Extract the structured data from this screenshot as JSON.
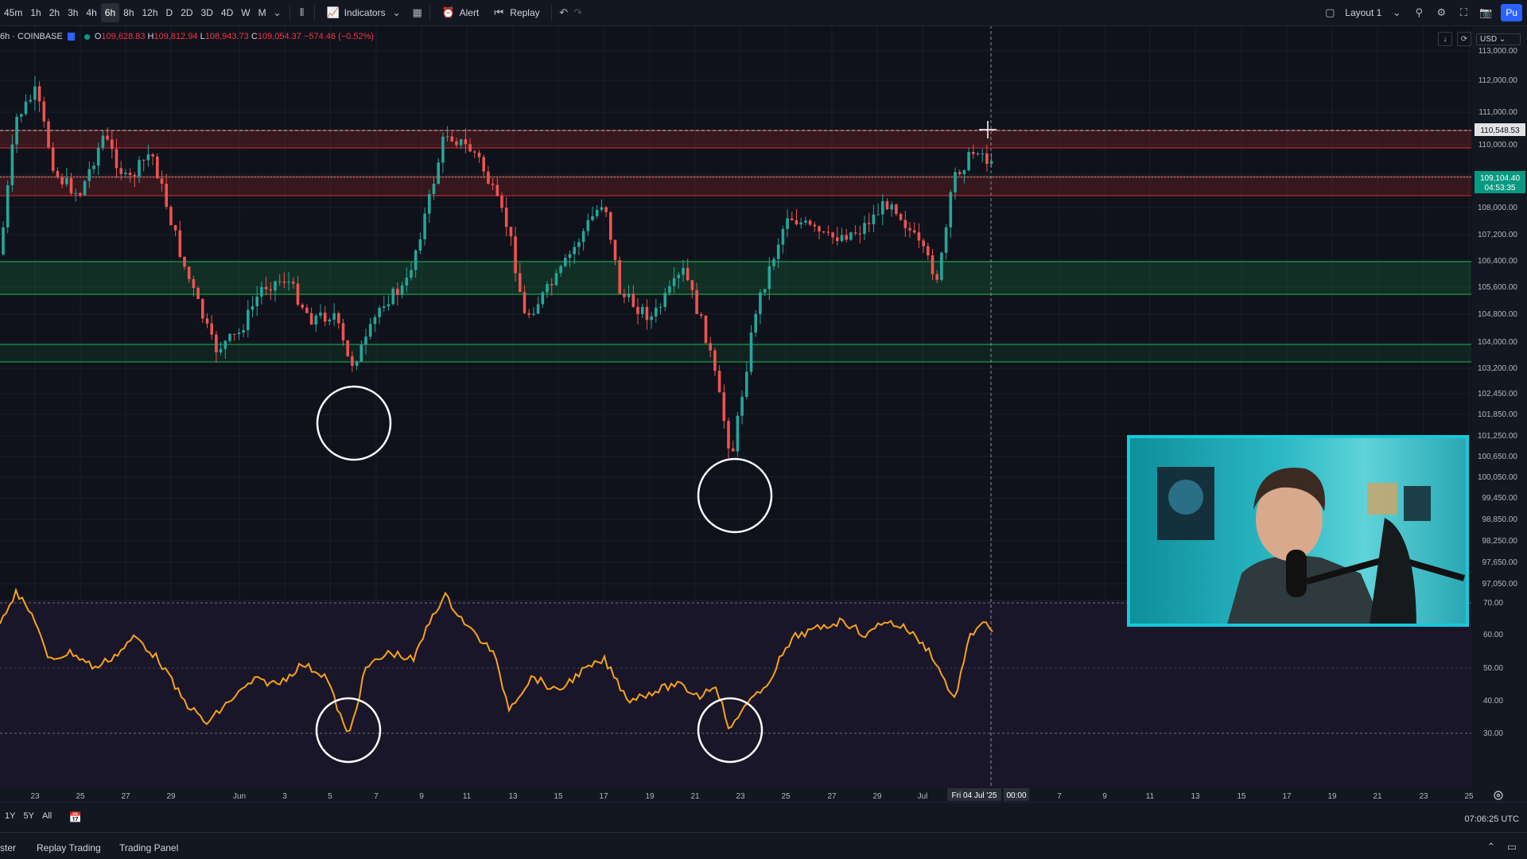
{
  "toolbar": {
    "timeframes": [
      "45m",
      "1h",
      "2h",
      "3h",
      "4h",
      "6h",
      "8h",
      "12h",
      "D",
      "2D",
      "3D",
      "4D",
      "W",
      "M"
    ],
    "active_timeframe": "6h",
    "indicators_label": "Indicators",
    "alert_label": "Alert",
    "replay_label": "Replay",
    "layout_label": "Layout 1",
    "publish_label": "Pu"
  },
  "legend": {
    "symbol": "6h · COINBASE",
    "open_label": "O",
    "open": "109,628.83",
    "high_label": "H",
    "high": "109,812.94",
    "low_label": "L",
    "low": "108,943.73",
    "close_label": "C",
    "close": "109,054.37",
    "change": "−574.46 (−0.52%)"
  },
  "price_scale": {
    "currency": "USD",
    "labels": [
      "113,000.00",
      "112,000.00",
      "111,000.00",
      "110,000.00",
      "108,800.00",
      "108,000.00",
      "107,200.00",
      "106,400.00",
      "105,600.00",
      "104,800.00",
      "104,000.00",
      "103,200.00",
      "102,450.00",
      "101,850.00",
      "101,250.00",
      "100,650.00",
      "100,050.00",
      "99,450.00",
      "98,850.00",
      "98,250.00",
      "97,650.00",
      "97,050.00"
    ],
    "crosshair_price": "110,548.53",
    "last_price": "109,104.40",
    "countdown": "04:53:35"
  },
  "rsi_scale": {
    "labels": [
      "70.00",
      "60.00",
      "50.00",
      "40.00",
      "30.00"
    ]
  },
  "time_axis": {
    "labels": [
      "23",
      "25",
      "27",
      "29",
      "Jun",
      "3",
      "5",
      "7",
      "9",
      "11",
      "13",
      "15",
      "17",
      "19",
      "21",
      "23",
      "25",
      "27",
      "29",
      "Jul",
      "7",
      "9",
      "11",
      "13",
      "15",
      "17",
      "19",
      "21",
      "23",
      "25"
    ],
    "crosshair_date": "Fri 04 Jul '25",
    "crosshair_time": "00:00"
  },
  "bottom": {
    "ranges": [
      "1Y",
      "5Y",
      "All"
    ],
    "clock": "07:06:25 UTC"
  },
  "tabs": [
    "ster",
    "Replay Trading",
    "Trading Panel"
  ],
  "colors": {
    "up": "#26a69a",
    "down": "#ef5350",
    "rsi": "#f7a21b",
    "resistance": "#c62828",
    "support": "#1db954",
    "webcam_border": "#18c9d8",
    "publish": "#2962ff"
  }
}
